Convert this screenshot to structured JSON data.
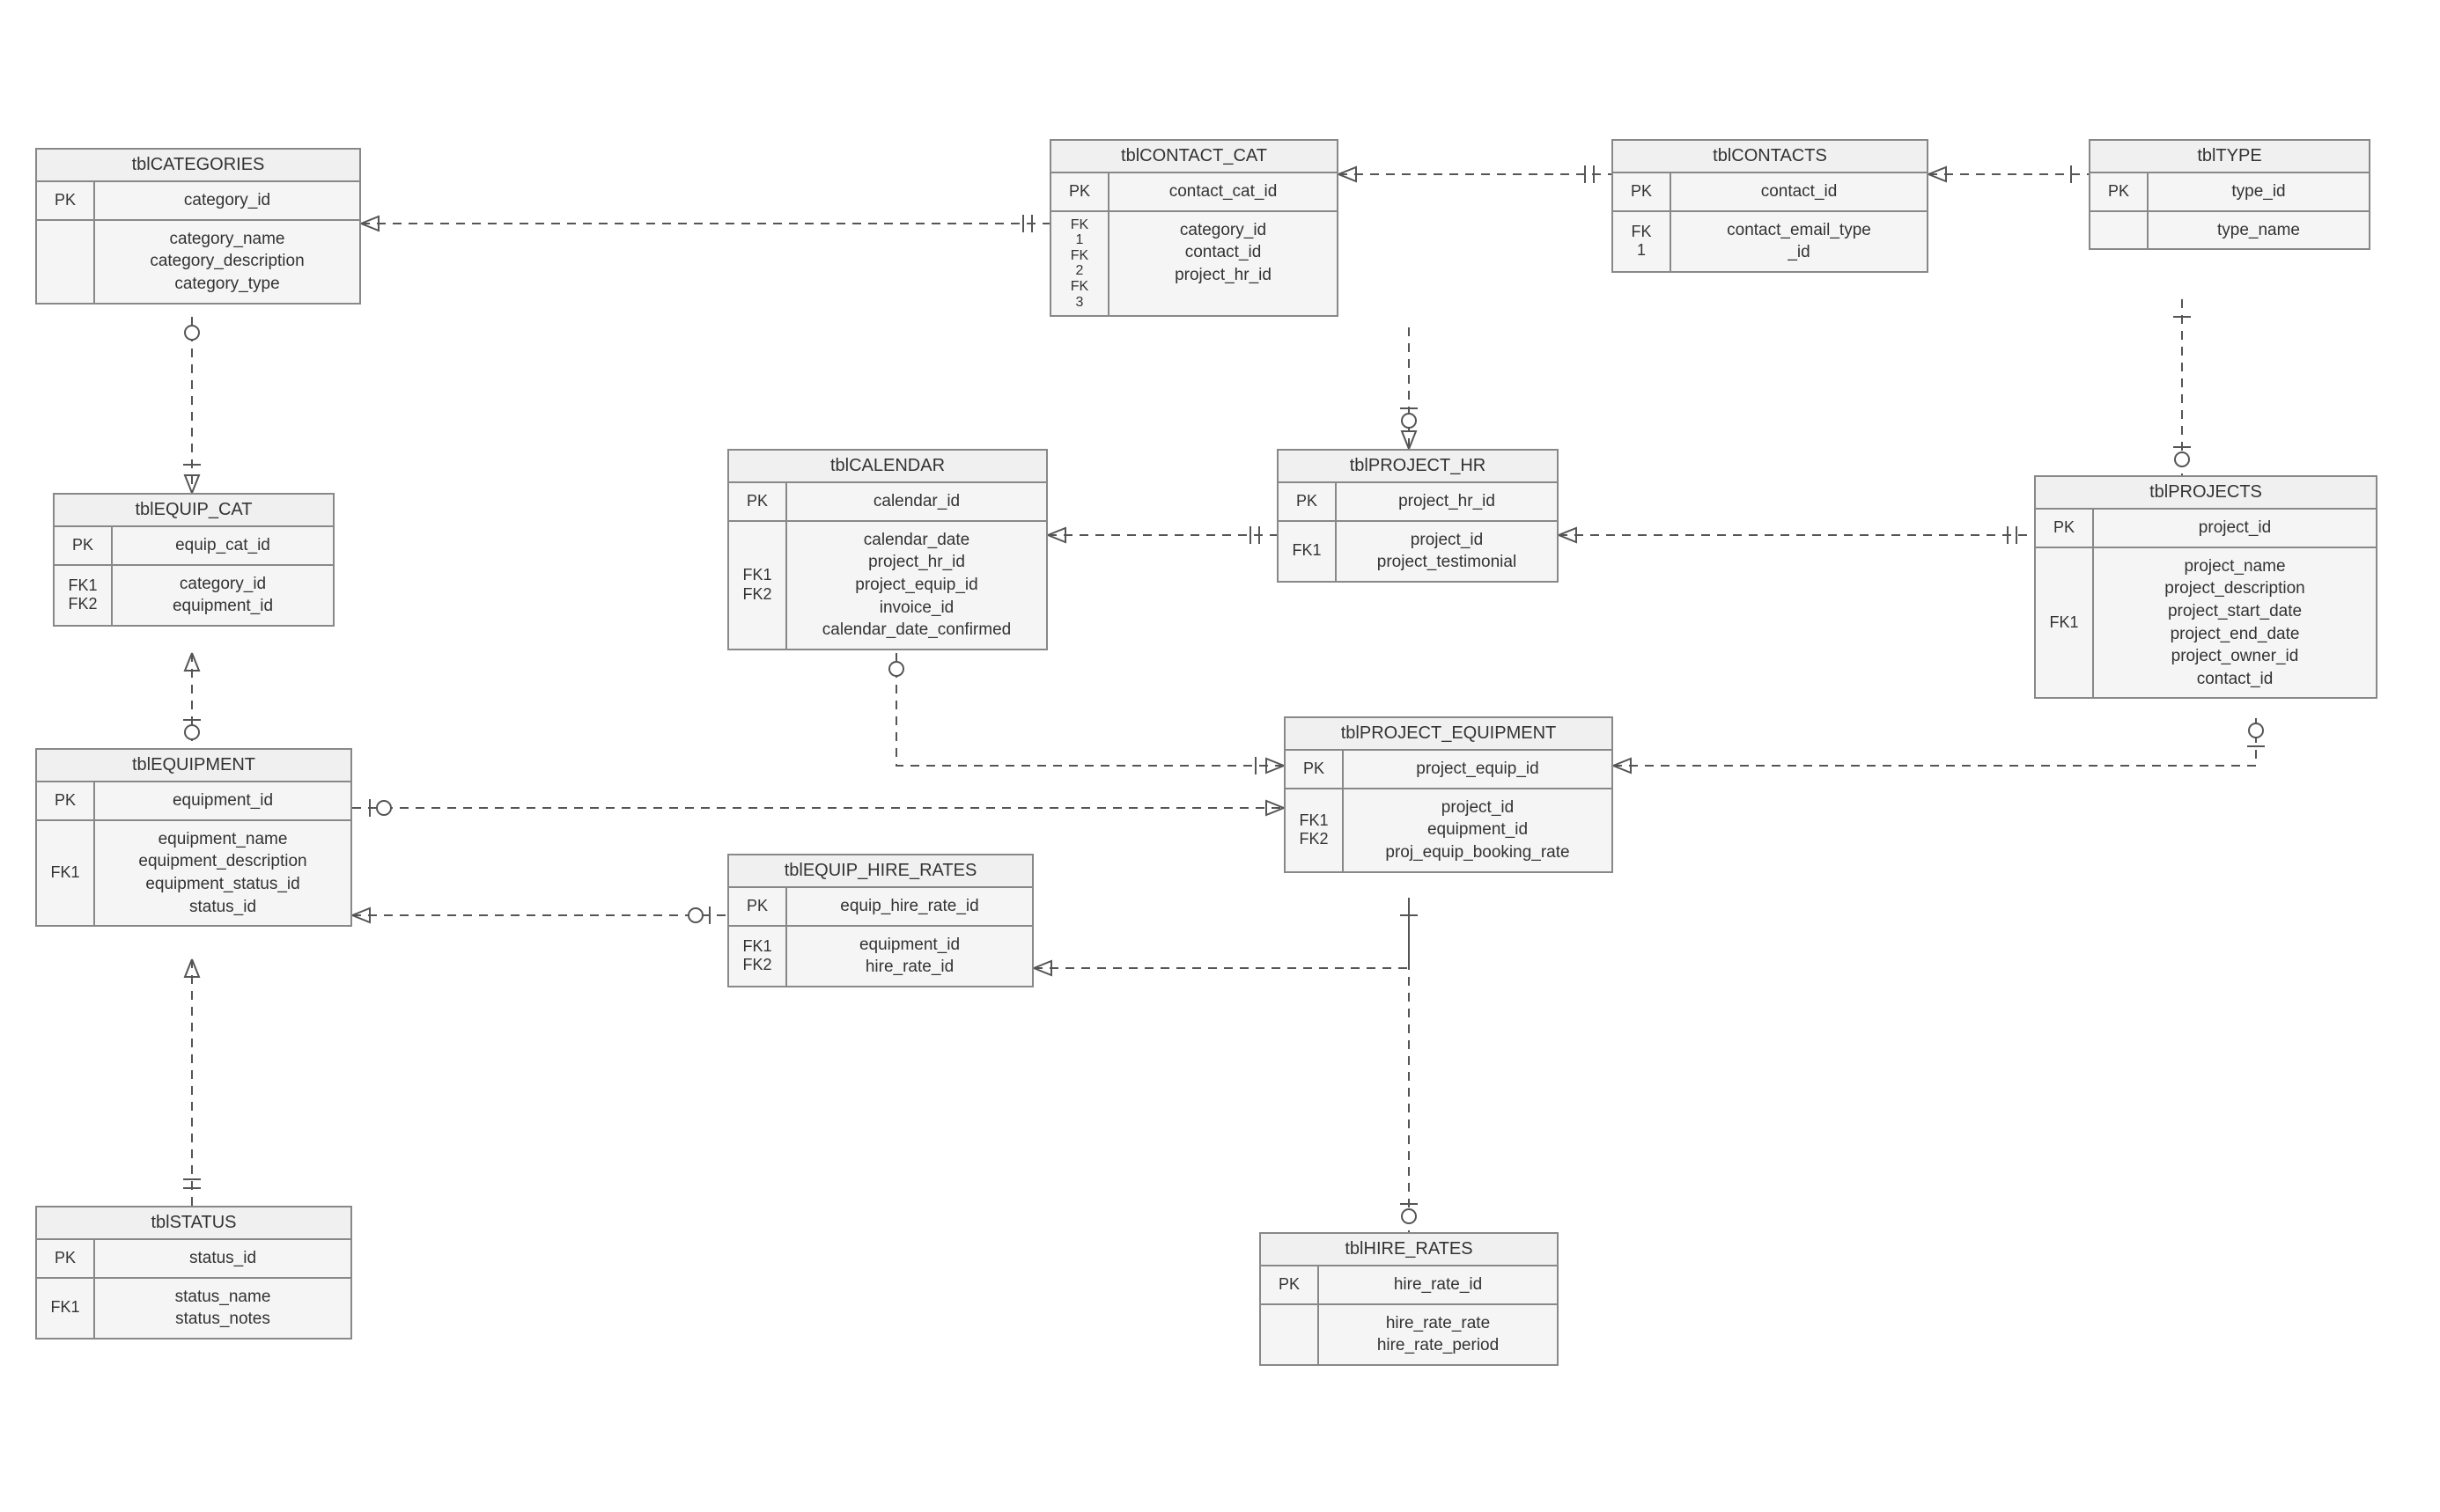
{
  "entities": {
    "categories": {
      "title": "tblCATEGORIES",
      "pk_label": "PK",
      "pk_field": "category_id",
      "attr_key": "",
      "attrs": [
        "category_name",
        "category_description",
        "category_type"
      ]
    },
    "equip_cat": {
      "title": "tblEQUIP_CAT",
      "pk_label": "PK",
      "pk_field": "equip_cat_id",
      "attr_key": "FK1\nFK2",
      "attrs": [
        "category_id",
        "equipment_id"
      ]
    },
    "equipment": {
      "title": "tblEQUIPMENT",
      "pk_label": "PK",
      "pk_field": "equipment_id",
      "attr_key": "FK1",
      "attrs": [
        "equipment_name",
        "equipment_description",
        "equipment_status_id",
        "status_id"
      ]
    },
    "status": {
      "title": "tblSTATUS",
      "pk_label": "PK",
      "pk_field": "status_id",
      "attr_key": "FK1",
      "attrs": [
        "status_name",
        "status_notes"
      ]
    },
    "contact_cat": {
      "title": "tblCONTACT_CAT",
      "pk_label": "PK",
      "pk_field": "contact_cat_id",
      "attr_key": "FK\n1\nFK\n2\nFK\n3",
      "attrs": [
        "category_id",
        "contact_id",
        "project_hr_id"
      ]
    },
    "contacts": {
      "title": "tblCONTACTS",
      "pk_label": "PK",
      "pk_field": "contact_id",
      "attr_key": "FK\n1",
      "attrs": [
        "contact_email_type\n_id"
      ]
    },
    "type": {
      "title": "tblTYPE",
      "pk_label": "PK",
      "pk_field": "type_id",
      "attr_key": "",
      "attrs": [
        "type_name"
      ]
    },
    "calendar": {
      "title": "tblCALENDAR",
      "pk_label": "PK",
      "pk_field": "calendar_id",
      "attr_key": "FK1\nFK2",
      "attrs": [
        "calendar_date",
        "project_hr_id",
        "project_equip_id",
        "invoice_id",
        "calendar_date_confirmed"
      ]
    },
    "project_hr": {
      "title": "tblPROJECT_HR",
      "pk_label": "PK",
      "pk_field": "project_hr_id",
      "attr_key": "FK1",
      "attrs": [
        "project_id",
        "project_testimonial"
      ]
    },
    "projects": {
      "title": "tblPROJECTS",
      "pk_label": "PK",
      "pk_field": "project_id",
      "attr_key": "FK1",
      "attrs": [
        "project_name",
        "project_description",
        "project_start_date",
        "project_end_date",
        "project_owner_id",
        "contact_id"
      ]
    },
    "project_equipment": {
      "title": "tblPROJECT_EQUIPMENT",
      "pk_label": "PK",
      "pk_field": "project_equip_id",
      "attr_key": "FK1\nFK2",
      "attrs": [
        "project_id",
        "equipment_id",
        "proj_equip_booking_rate"
      ]
    },
    "equip_hire_rates": {
      "title": "tblEQUIP_HIRE_RATES",
      "pk_label": "PK",
      "pk_field": "equip_hire_rate_id",
      "attr_key": "FK1\nFK2",
      "attrs": [
        "equipment_id",
        "hire_rate_id"
      ]
    },
    "hire_rates": {
      "title": "tblHIRE_RATES",
      "pk_label": "PK",
      "pk_field": "hire_rate_id",
      "attr_key": "",
      "attrs": [
        "hire_rate_rate",
        "hire_rate_period"
      ]
    }
  }
}
